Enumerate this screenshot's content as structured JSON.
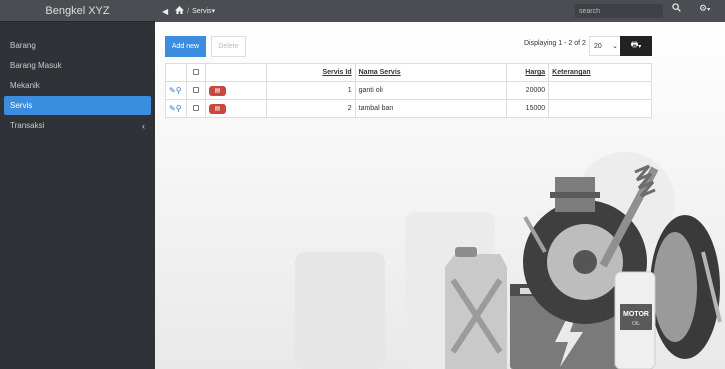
{
  "brand": "Bengkel XYZ",
  "sidebar": {
    "items": [
      {
        "label": "Barang"
      },
      {
        "label": "Barang Masuk"
      },
      {
        "label": "Mekanik"
      },
      {
        "label": "Servis",
        "active": true
      },
      {
        "label": "Transaksi",
        "expandable": true
      }
    ]
  },
  "topbar": {
    "breadcrumb": "Servis",
    "search_placeholder": "search"
  },
  "toolbar": {
    "add_label": "Add new",
    "delete_label": "Delete",
    "paging_text": "Displaying 1 - 2 of 2",
    "page_size": "20"
  },
  "table": {
    "headers": {
      "id": "Servis Id",
      "nama": "Nama Servis",
      "harga": "Harga",
      "ket": "Keterangan"
    },
    "rows": [
      {
        "id": "1",
        "nama": "ganti oli",
        "harga": "20000",
        "ket": ""
      },
      {
        "id": "2",
        "nama": "tambal ban",
        "harga": "15000",
        "ket": ""
      }
    ]
  },
  "illustration": {
    "motor_label": "MOTOR",
    "oil_label": "OIL"
  },
  "colors": {
    "accent": "#3b8de0",
    "sidebar_bg": "#2f3337",
    "topbar_bg": "#4a4e52",
    "delete_badge": "#c9473d"
  }
}
